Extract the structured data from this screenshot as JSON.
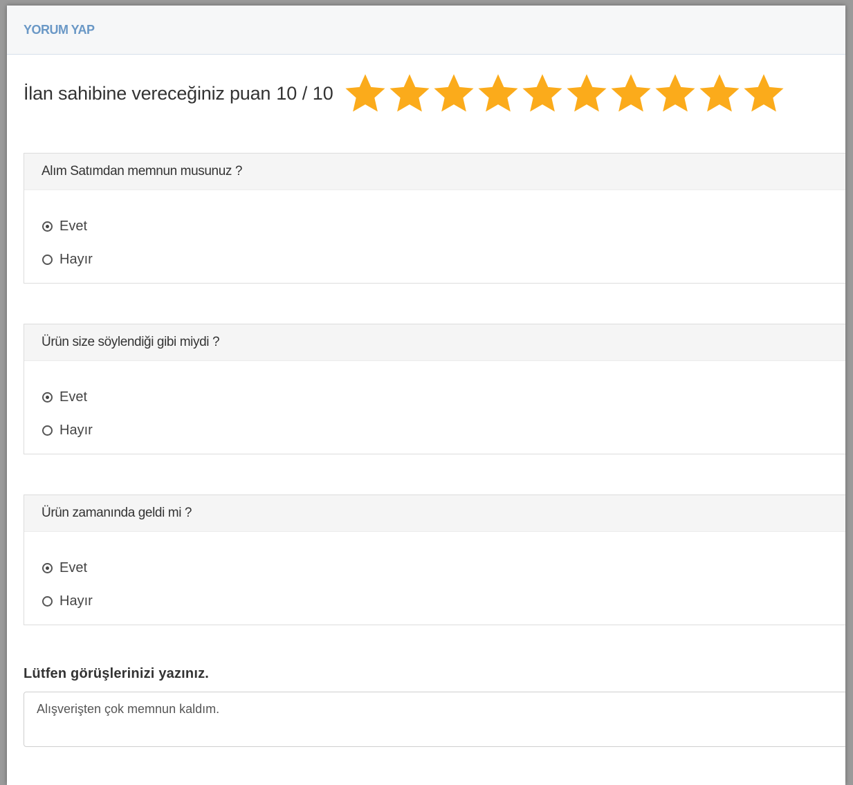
{
  "header": {
    "title": "YORUM YAP"
  },
  "rating": {
    "label": "İlan sahibine vereceğiniz puan",
    "value_text": "10 / 10",
    "score": 10,
    "max": 10,
    "star_color": "#fbab1b"
  },
  "questions": [
    {
      "title": "Alım Satımdan memnun musunuz ?",
      "options": [
        "Evet",
        "Hayır"
      ],
      "selected": "Evet"
    },
    {
      "title": "Ürün size söylendiği gibi miydi ?",
      "options": [
        "Evet",
        "Hayır"
      ],
      "selected": "Evet"
    },
    {
      "title": "Ürün zamanında geldi mi ?",
      "options": [
        "Evet",
        "Hayır"
      ],
      "selected": "Evet"
    }
  ],
  "comment": {
    "label": "Lütfen görüşlerinizi yazınız.",
    "value": "Alışverişten çok memnun kaldım."
  }
}
